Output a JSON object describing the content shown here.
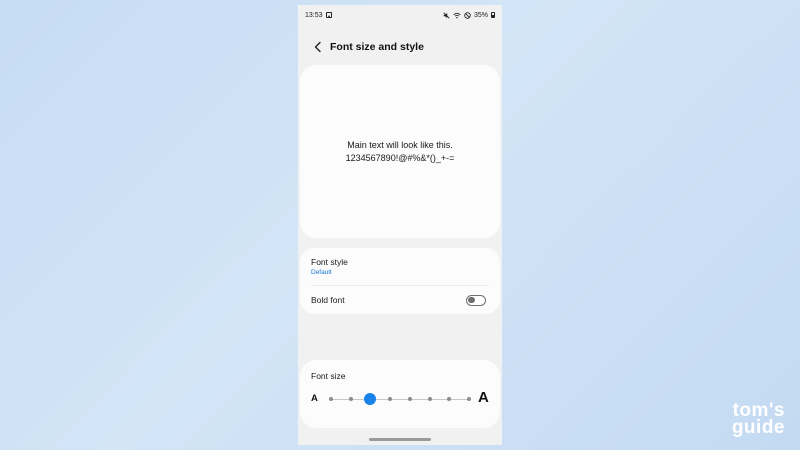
{
  "status_bar": {
    "time": "13:53",
    "battery": "35%",
    "icons": [
      "gallery-icon",
      "mute-icon",
      "wifi-icon",
      "do-not-disturb-icon",
      "battery-icon"
    ]
  },
  "header": {
    "back_icon": "chevron-left-icon",
    "title": "Font size and style"
  },
  "preview": {
    "line1": "Main text will look like this.",
    "line2": "1234567890!@#%&*()_+-="
  },
  "settings": {
    "font_style": {
      "label": "Font style",
      "value": "Default"
    },
    "bold_font": {
      "label": "Bold font",
      "enabled": false
    }
  },
  "font_size": {
    "title": "Font size",
    "small_label": "A",
    "large_label": "A",
    "step_count": 8,
    "selected_step": 2
  },
  "watermark": {
    "line1": "tom's",
    "line2": "guide"
  },
  "colors": {
    "accent": "#1a82e8",
    "link": "#1677d6",
    "background": "#c6dcf3"
  }
}
